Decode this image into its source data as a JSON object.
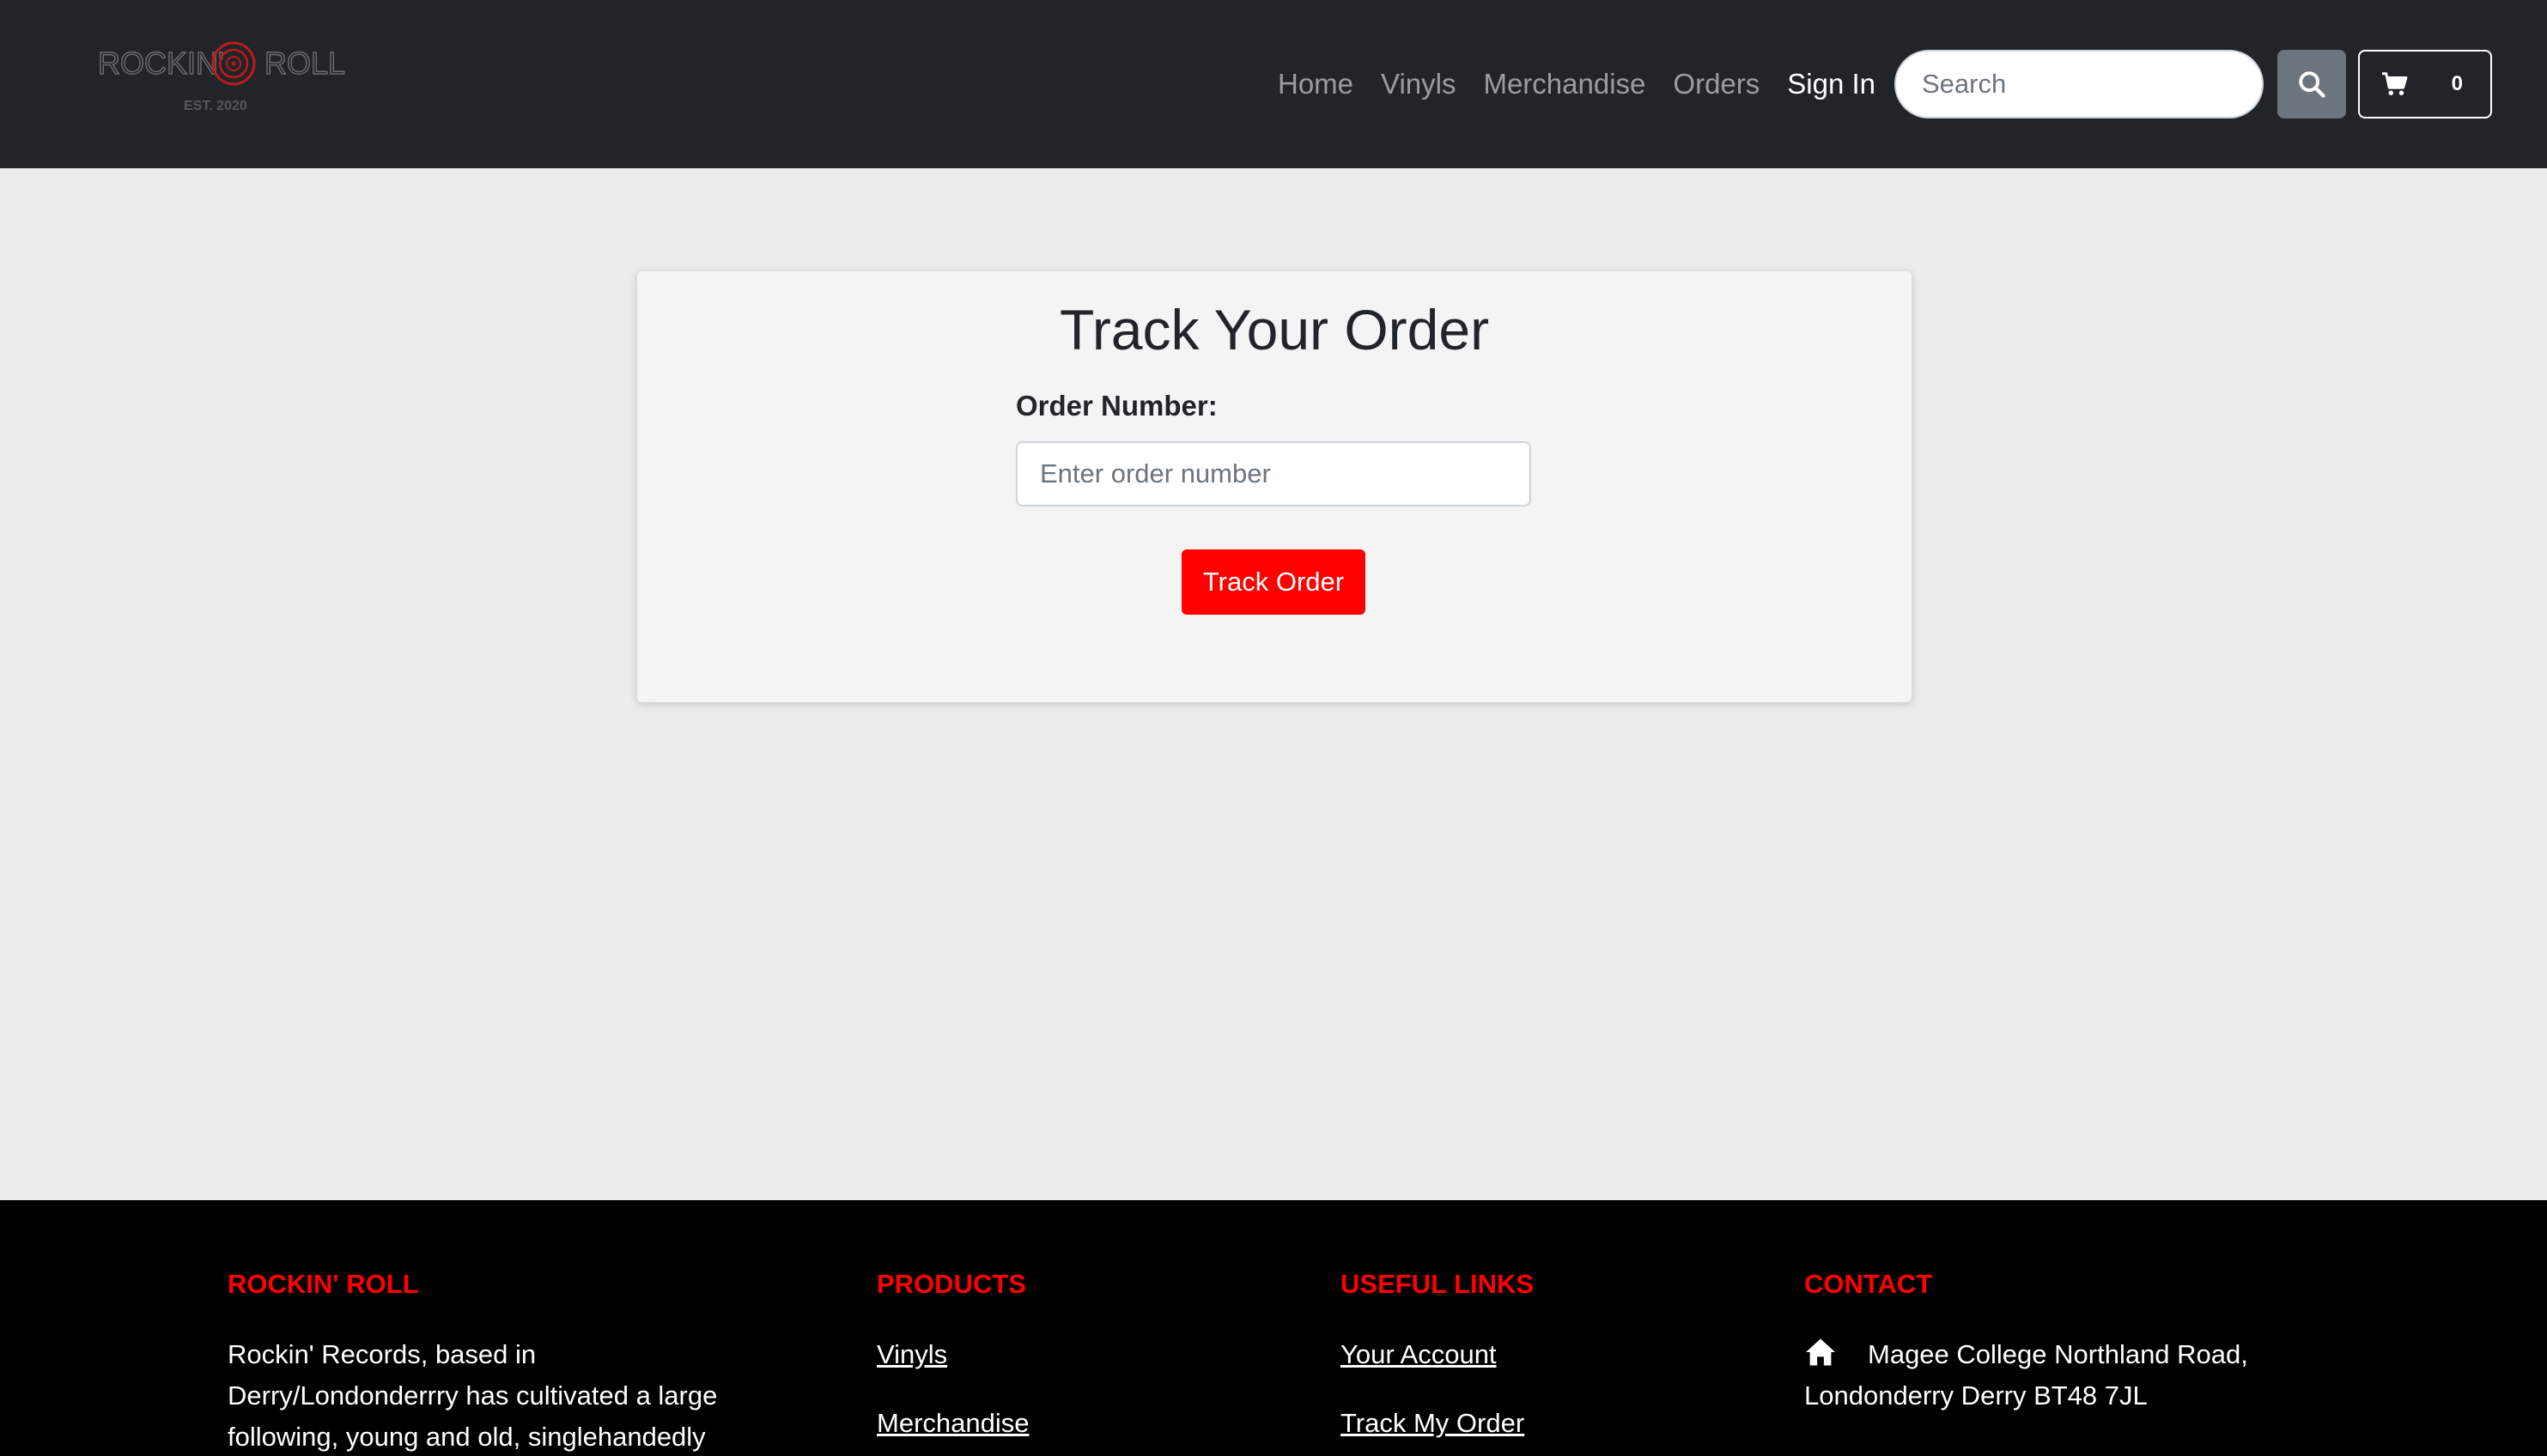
{
  "navbar": {
    "logo": {
      "left_word": "ROCKIN'",
      "right_word": "ROLL",
      "tagline": "EST. 2020"
    },
    "links": [
      {
        "label": "Home"
      },
      {
        "label": "Vinyls"
      },
      {
        "label": "Merchandise"
      },
      {
        "label": "Orders"
      }
    ],
    "signin_label": "Sign In",
    "search": {
      "placeholder": "Search",
      "value": ""
    },
    "search_icon": "search-icon",
    "cart": {
      "icon": "cart-icon",
      "count": "0"
    }
  },
  "main": {
    "title": "Track Your Order",
    "field_label": "Order Number:",
    "order_input": {
      "placeholder": "Enter order number",
      "value": ""
    },
    "button_label": "Track Order"
  },
  "footer": {
    "about": {
      "heading": "ROCKIN' ROLL",
      "text": "Rockin' Records, based in Derry/Londonderrry has cultivated a large following, young and old, singlehandedly"
    },
    "products": {
      "heading": "PRODUCTS",
      "links": [
        {
          "label": "Vinyls"
        },
        {
          "label": "Merchandise"
        }
      ]
    },
    "useful_links": {
      "heading": "USEFUL LINKS",
      "links": [
        {
          "label": "Your Account"
        },
        {
          "label": "Track My Order"
        }
      ]
    },
    "contact": {
      "heading": "CONTACT",
      "icon": "home-icon",
      "address": "Magee College Northland Road, Londonderry Derry BT48 7JL"
    }
  },
  "colors": {
    "navbar_bg": "#212529",
    "accent_red": "#ff0000",
    "footer_bg": "#000000",
    "page_bg": "#ececec",
    "card_bg": "#f4f4f4"
  }
}
